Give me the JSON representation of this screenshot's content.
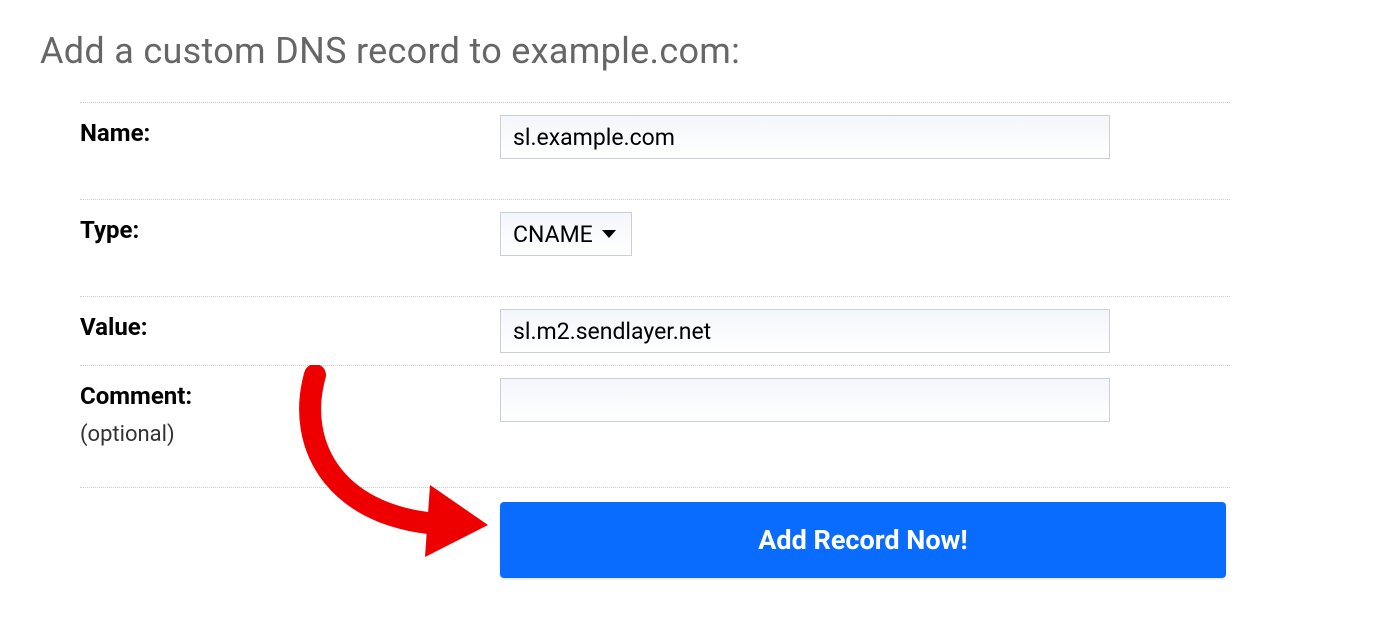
{
  "header": {
    "title": "Add a custom DNS record to example.com:"
  },
  "form": {
    "name": {
      "label": "Name:",
      "value": "sl.example.com"
    },
    "type": {
      "label": "Type:",
      "selected": "CNAME"
    },
    "value": {
      "label": "Value:",
      "value": "sl.m2.sendlayer.net"
    },
    "comment": {
      "label": "Comment:",
      "optional_text": "(optional)",
      "value": ""
    },
    "submit_label": "Add Record Now!"
  }
}
